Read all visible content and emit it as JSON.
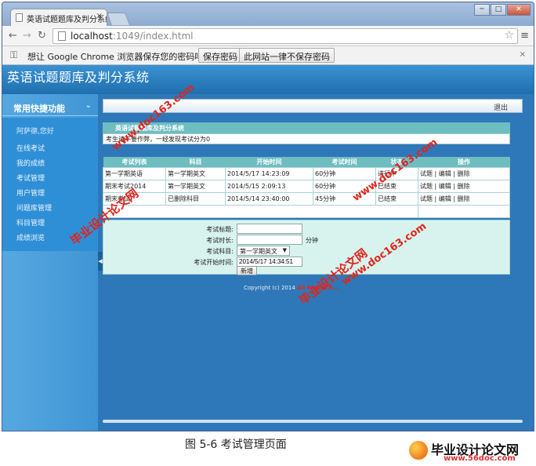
{
  "browser": {
    "tab_title": "英语试题题库及判分系统",
    "tab_close": "×",
    "url_host": "localhost",
    "url_path": ":1049/index.html",
    "infobar_message": "想让 Google Chrome 浏览器保存您的密码吗？",
    "save_password_label": "保存密码",
    "never_save_label": "此网站一律不保存密码",
    "infobar_close": "×",
    "window_minimize": "─",
    "window_maximize": "□",
    "window_close": "✕"
  },
  "app": {
    "title": "英语试题题库及判分系统",
    "logout_label": "退出",
    "copyright": "Copyright (c) 2014 ",
    "copyright_rights": "All Rights R..."
  },
  "sidebar": {
    "header": "常用快捷功能",
    "user_greeting": "阿萨德,您好",
    "items": [
      {
        "label": "在线考试"
      },
      {
        "label": "我的成绩"
      },
      {
        "label": "考试管理"
      },
      {
        "label": "用户管理"
      },
      {
        "label": "问题库管理"
      },
      {
        "label": "科目管理"
      },
      {
        "label": "成绩浏览"
      }
    ]
  },
  "panel": {
    "caption": "英语试题题库及判分系统",
    "notice": "考生请不要作弊，一经发现考试分为0"
  },
  "exam_table": {
    "headers": [
      "考试列表",
      "科目",
      "开始时间",
      "考试时间",
      "状态",
      "操作"
    ],
    "rows": [
      {
        "name": "第一学期英语",
        "subject": "第一学期英文",
        "start": "2014/5/17 14:23:09",
        "duration": "60分钟",
        "status": "进行中",
        "status_kind": "running",
        "op_exam": "试题",
        "op_edit": "编辑",
        "op_delete": "删除"
      },
      {
        "name": "期末考试2014",
        "subject": "第一学期英文",
        "start": "2014/5/15 2:09:13",
        "duration": "60分钟",
        "status": "已结束",
        "status_kind": "ended",
        "op_exam": "试题",
        "op_edit": "编辑",
        "op_delete": "删除"
      },
      {
        "name": "期末考试",
        "subject": "已删除科目",
        "start": "2014/5/14 23:40:00",
        "duration": "45分钟",
        "status": "已结束",
        "status_kind": "ended",
        "op_exam": "试题",
        "op_edit": "编辑",
        "op_delete": "删除"
      }
    ],
    "op_separator": "|"
  },
  "form": {
    "title_label": "考试标题:",
    "title_value": "",
    "duration_label": "考试时长:",
    "duration_value": "",
    "duration_unit": "分钟",
    "subject_label": "考试科目:",
    "subject_value": "第一学期英文",
    "start_label": "考试开始时间:",
    "start_value": "2014/5/17 14:34:51",
    "submit_label": "新增"
  },
  "watermarks": {
    "cn": "毕业设计论文网",
    "url": "www.doc163.com"
  },
  "figure": {
    "caption": "图 5-6  考试管理页面",
    "logo_cn": "毕业设计论文网",
    "logo_url": "www.56doc.com"
  },
  "colors": {
    "app_blue": "#2e78b9",
    "table_header": "#6ebdc1",
    "status_running": "#dd1111",
    "watermark_red": "#e0251b"
  }
}
